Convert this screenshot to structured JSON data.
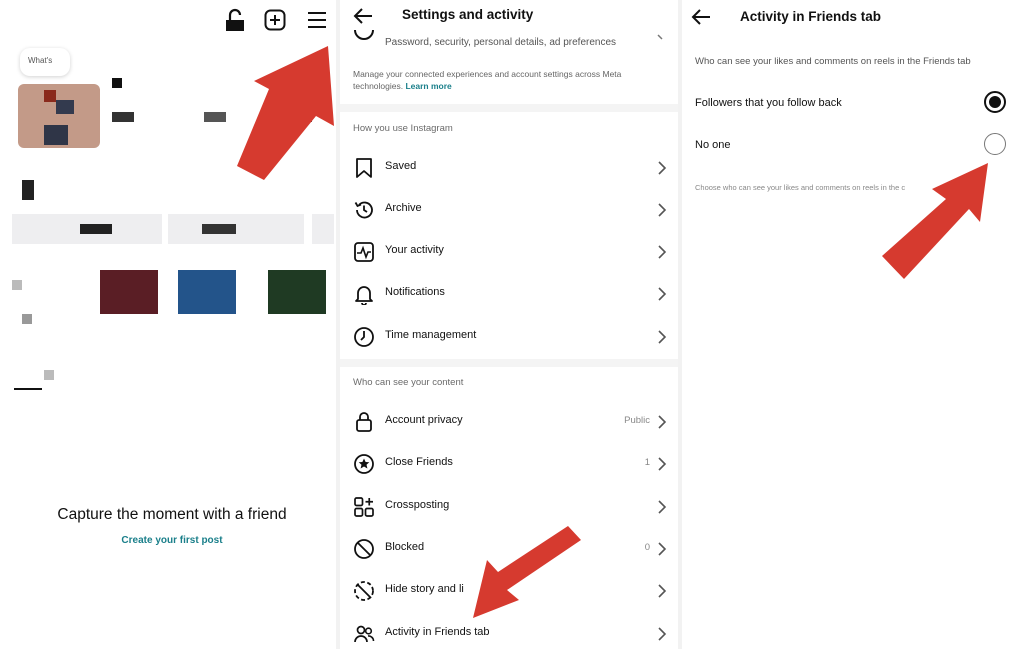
{
  "profile": {
    "bubble_text": "What's",
    "empty_title": "Capture the moment with a friend",
    "create_link": "Create your first post"
  },
  "settings": {
    "title": "Settings and activity",
    "account_subtitle": "Password, security, personal details, ad preferences",
    "meta_note": "Manage your connected experiences and account settings across Meta technologies.",
    "meta_link": "Learn more",
    "section_usage": "How you use Instagram",
    "usage_items": [
      {
        "label": "Saved",
        "icon": "bookmark-icon"
      },
      {
        "label": "Archive",
        "icon": "archive-icon"
      },
      {
        "label": "Your activity",
        "icon": "activity-icon"
      },
      {
        "label": "Notifications",
        "icon": "bell-icon"
      },
      {
        "label": "Time management",
        "icon": "clock-icon"
      }
    ],
    "section_content": "Who can see your content",
    "content_items": [
      {
        "label": "Account privacy",
        "value": "Public",
        "icon": "lock-icon"
      },
      {
        "label": "Close Friends",
        "value": "1",
        "icon": "star-icon"
      },
      {
        "label": "Crossposting",
        "value": "",
        "icon": "crossposting-icon"
      },
      {
        "label": "Blocked",
        "value": "0",
        "icon": "blocked-icon"
      },
      {
        "label": "Hide story and li",
        "value": "",
        "icon": "hide-story-icon"
      },
      {
        "label": "Activity in Friends tab",
        "value": "",
        "icon": "friends-icon"
      }
    ]
  },
  "friends_tab": {
    "title": "Activity in Friends tab",
    "question": "Who can see your likes and comments on reels in the Friends tab",
    "options": [
      {
        "label": "Followers that you follow back",
        "selected": true
      },
      {
        "label": "No one",
        "selected": false
      }
    ],
    "note": "Choose who can see your likes and comments on reels in the c"
  },
  "colors": {
    "accent_link": "#1a7f8a",
    "arrow": "#d63a2f"
  }
}
